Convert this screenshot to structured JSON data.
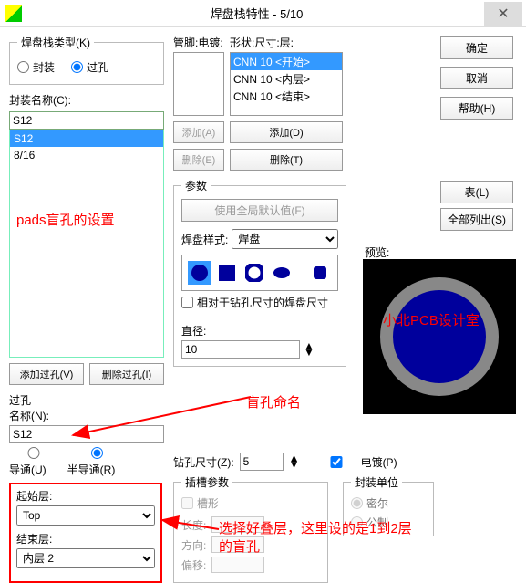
{
  "window": {
    "title": "焊盘栈特性 - 5/10"
  },
  "buttons": {
    "ok": "确定",
    "cancel": "取消",
    "help": "帮助(H)",
    "table": "表(L)",
    "listall": "全部列出(S)"
  },
  "padtype": {
    "legend": "焊盘栈类型(K)",
    "opt1": "封装",
    "opt2": "过孔",
    "selected": "过孔"
  },
  "pkg": {
    "label": "封装名称(C):",
    "input": "S12",
    "items": [
      "S12",
      "8/16"
    ]
  },
  "addvia": "添加过孔(V)",
  "delvia": "删除过孔(I)",
  "via": {
    "label1": "过孔",
    "label2": "名称(N):",
    "value": "S12",
    "opt1": "导通(U)",
    "opt2": "半导通(R)",
    "selected": "半导通(R)"
  },
  "layers": {
    "start_label": "起始层:",
    "start": "Top",
    "end_label": "结束层:",
    "end": "内层 2"
  },
  "pin": {
    "label": "管脚:电镀:"
  },
  "shape": {
    "label": "形状:尺寸:层:",
    "items": [
      "CNN 10 <开始>",
      "CNN 10 <内层>",
      "CNN 10 <结束>"
    ]
  },
  "midbtns": {
    "addA": "添加(A)",
    "addD": "添加(D)",
    "delE": "删除(E)",
    "delT": "删除(T)"
  },
  "params": {
    "legend": "参数",
    "usedef": "使用全局默认值(F)",
    "style_label": "焊盘样式:",
    "style": "焊盘",
    "relchk": "相对于钻孔尺寸的焊盘尺寸",
    "diam_label": "直径:",
    "diam": "10"
  },
  "drill": {
    "label": "钻孔尺寸(Z):",
    "val": "5",
    "plated": "电镀(P)"
  },
  "slot": {
    "legend": "插槽参数",
    "opt": "槽形",
    "len": "长度:",
    "dir": "方向:",
    "off": "偏移:"
  },
  "unit": {
    "legend": "封装单位",
    "mil": "密尔",
    "mm": "公制"
  },
  "preview": {
    "label": "预览:",
    "watermark": "小北PCB设计室"
  },
  "annotations": {
    "a1": "pads盲孔的设置",
    "a2": "盲孔命名",
    "a3": "选择好叠层，这里设的是1到2层的盲孔"
  }
}
